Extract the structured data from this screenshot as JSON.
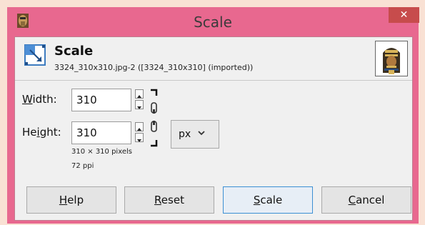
{
  "window": {
    "title": "Scale",
    "close_glyph": "✕"
  },
  "header": {
    "title": "Scale",
    "subtitle": "3324_310x310.jpg-2 ([3324_310x310] (imported))"
  },
  "width": {
    "label_mnemonic": "W",
    "label_rest": "idth:",
    "value": "310"
  },
  "height": {
    "label_before": "He",
    "label_mnemonic": "i",
    "label_after": "ght:",
    "value": "310"
  },
  "unit": {
    "selected": "px"
  },
  "info": {
    "size": "310 × 310 pixels",
    "resolution": "72 ppi"
  },
  "buttons": {
    "help": {
      "mnemonic": "H",
      "rest": "elp"
    },
    "reset": {
      "mnemonic": "R",
      "rest": "eset"
    },
    "scale": {
      "mnemonic": "S",
      "rest": "cale"
    },
    "cancel": {
      "mnemonic": "C",
      "rest": "ancel"
    }
  },
  "icons": {
    "app": "gimp-app-icon",
    "scale_tool": "scale-tool-icon",
    "preview": "image-preview-thumbnail",
    "chain": "chain-link-icon",
    "chevron": "chevron-down-icon"
  },
  "colors": {
    "window_frame": "#e8688f",
    "close_button": "#c74c4c",
    "default_button_border": "#3c8fd3"
  }
}
